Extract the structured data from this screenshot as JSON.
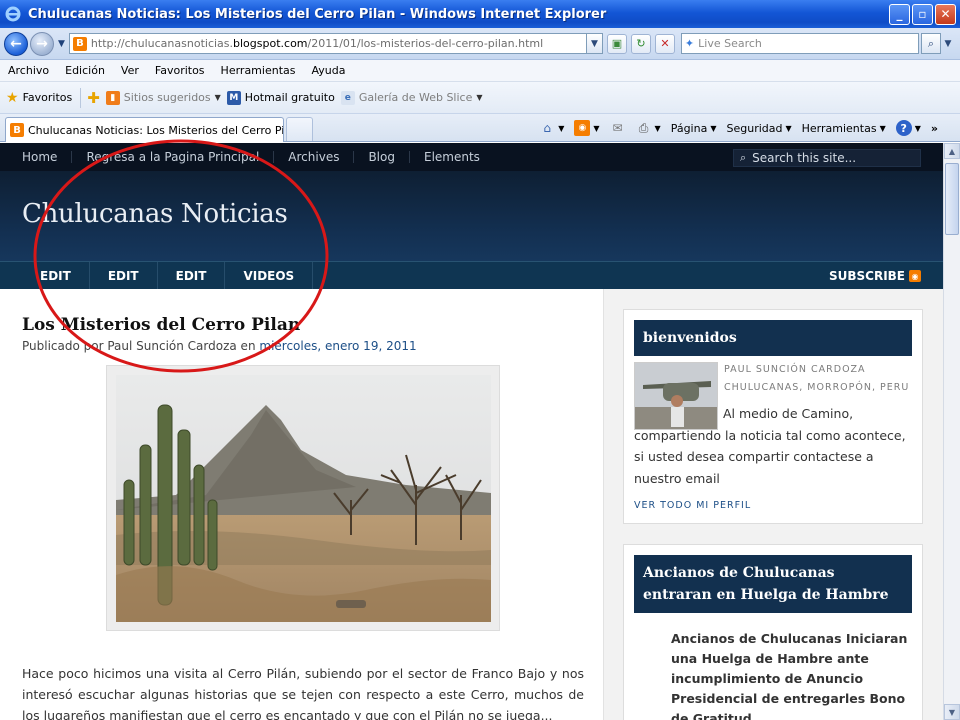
{
  "window": {
    "title": "Chulucanas Noticias: Los Misterios del Cerro Pilan - Windows Internet Explorer"
  },
  "addressbar": {
    "url_prefix": "http://chulucanasnoticias.",
    "url_host": "blogspot.com",
    "url_path": "/2011/01/los-misterios-del-cerro-pilan.html",
    "search_placeholder": "Live Search"
  },
  "menubar": {
    "items": [
      "Archivo",
      "Edición",
      "Ver",
      "Favoritos",
      "Herramientas",
      "Ayuda"
    ]
  },
  "favorites_bar": {
    "favorites_label": "Favoritos",
    "items": [
      {
        "label": "Sitios sugeridos",
        "icon": "suggested-sites-icon"
      },
      {
        "label": "Hotmail gratuito",
        "icon": "hotmail-icon"
      },
      {
        "label": "Galería de Web Slice",
        "icon": "web-slice-icon"
      }
    ]
  },
  "tabs": {
    "active_label": "Chulucanas Noticias: Los Misterios del Cerro Pilan"
  },
  "command_bar": {
    "page_label": "Página",
    "security_label": "Seguridad",
    "tools_label": "Herramientas"
  },
  "site": {
    "top_nav": [
      "Home",
      "Regresa a la Pagina Principal",
      "Archives",
      "Blog",
      "Elements"
    ],
    "search_placeholder": "Search this site...",
    "title": "Chulucanas Noticias",
    "main_nav": [
      "EDIT",
      "EDIT",
      "EDIT",
      "VIDEOS"
    ],
    "subscribe_label": "SUBSCRIBE"
  },
  "post": {
    "title": "Los Misterios del Cerro Pilan",
    "meta_prefix": "Publicado por Paul Sunción Cardoza en",
    "meta_date": "miércoles, enero 19, 2011",
    "image_alt": "Cerro Pilan",
    "body": "Hace poco hicimos una visita al Cerro Pilán, subiendo por el sector de Franco Bajo y nos interesó escuchar algunas historias que se tejen con respecto a este Cerro, muchos de los lugareños manifiestan que el cerro es encantado y que con el Pilán no se juega..."
  },
  "sidebar": {
    "profile_widget": {
      "heading": "bienvenidos",
      "name": "PAUL SUNCIÓN CARDOZA",
      "location": "CHULUCANAS, MORROPÓN, PERU",
      "about": "Al medio de Camino, compartiendo la noticia tal como acontece, si usted desea compartir contactese a nuestro email",
      "profile_link": "VER TODO MI PERFIL"
    },
    "news_widget": {
      "heading": "Ancianos de Chulucanas entraran en Huelga de Hambre",
      "body": "Ancianos de Chulucanas Iniciaran una Huelga de Hambre ante incumplimiento de Anuncio Presidencial de entregarles Bono de Gratitud"
    }
  },
  "colors": {
    "title_bar": "#1356d6",
    "site_header": "#133052",
    "site_nav": "#0f3552",
    "widget_head": "#12304f",
    "annotation": "#d81818"
  }
}
